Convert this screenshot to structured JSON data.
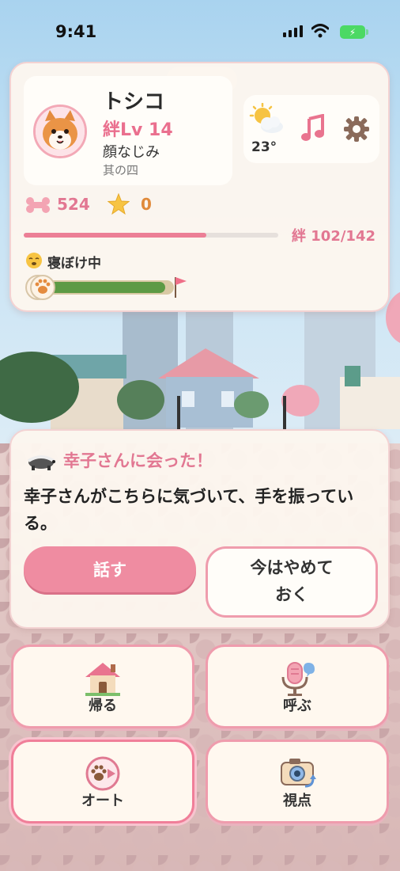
{
  "status_bar": {
    "time": "9:41"
  },
  "profile": {
    "name": "トシコ",
    "level": "絆Lv 14",
    "rank": "顔なじみ",
    "subrank": "其の四"
  },
  "weather": {
    "icon": "partly-cloudy-icon",
    "temperature": "23°"
  },
  "header_icons": [
    "music-note-icon",
    "gear-icon"
  ],
  "stats": {
    "bones": "524",
    "stars": "0"
  },
  "bond": {
    "label": "絆 102/142",
    "current": 102,
    "max": 142
  },
  "sleep": {
    "label": "寝ぼけ中",
    "progress": 0.95
  },
  "encounter": {
    "title": "幸子さんに会った！",
    "body": "幸子さんがこちらに気づいて、手を振っている。",
    "talk_button": "話す",
    "skip_button": "今はやめて おく"
  },
  "actions": [
    {
      "label": "帰る",
      "icon": "house-icon"
    },
    {
      "label": "呼ぶ",
      "icon": "microphone-icon"
    },
    {
      "label": "オート",
      "icon": "paw-play-icon"
    },
    {
      "label": "視点",
      "icon": "camera-rotate-icon"
    }
  ],
  "colors": {
    "accent": "#ef8ca1",
    "panel": "#fcf6ee",
    "bond_fill": "#ec7f96",
    "sleep_fill": "#5d9a45"
  }
}
